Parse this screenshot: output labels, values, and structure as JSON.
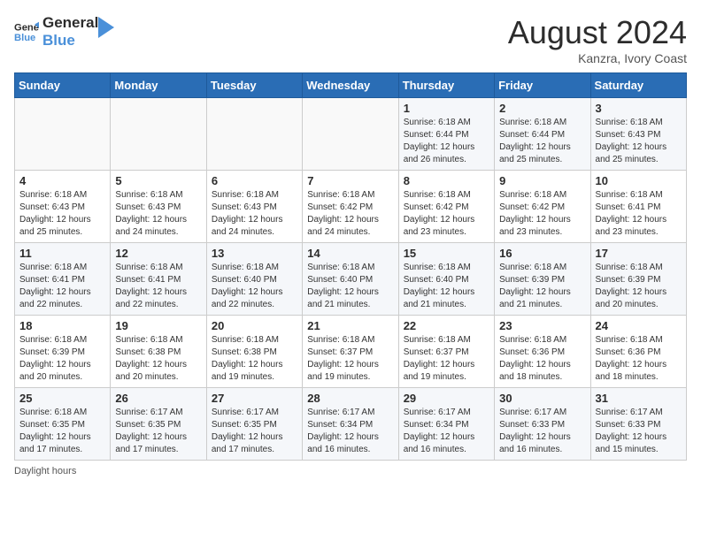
{
  "header": {
    "logo_line1": "General",
    "logo_line2": "Blue",
    "month_year": "August 2024",
    "location": "Kanzra, Ivory Coast"
  },
  "days_of_week": [
    "Sunday",
    "Monday",
    "Tuesday",
    "Wednesday",
    "Thursday",
    "Friday",
    "Saturday"
  ],
  "weeks": [
    [
      {
        "day": "",
        "info": ""
      },
      {
        "day": "",
        "info": ""
      },
      {
        "day": "",
        "info": ""
      },
      {
        "day": "",
        "info": ""
      },
      {
        "day": "1",
        "info": "Sunrise: 6:18 AM\nSunset: 6:44 PM\nDaylight: 12 hours\nand 26 minutes."
      },
      {
        "day": "2",
        "info": "Sunrise: 6:18 AM\nSunset: 6:44 PM\nDaylight: 12 hours\nand 25 minutes."
      },
      {
        "day": "3",
        "info": "Sunrise: 6:18 AM\nSunset: 6:43 PM\nDaylight: 12 hours\nand 25 minutes."
      }
    ],
    [
      {
        "day": "4",
        "info": "Sunrise: 6:18 AM\nSunset: 6:43 PM\nDaylight: 12 hours\nand 25 minutes."
      },
      {
        "day": "5",
        "info": "Sunrise: 6:18 AM\nSunset: 6:43 PM\nDaylight: 12 hours\nand 24 minutes."
      },
      {
        "day": "6",
        "info": "Sunrise: 6:18 AM\nSunset: 6:43 PM\nDaylight: 12 hours\nand 24 minutes."
      },
      {
        "day": "7",
        "info": "Sunrise: 6:18 AM\nSunset: 6:42 PM\nDaylight: 12 hours\nand 24 minutes."
      },
      {
        "day": "8",
        "info": "Sunrise: 6:18 AM\nSunset: 6:42 PM\nDaylight: 12 hours\nand 23 minutes."
      },
      {
        "day": "9",
        "info": "Sunrise: 6:18 AM\nSunset: 6:42 PM\nDaylight: 12 hours\nand 23 minutes."
      },
      {
        "day": "10",
        "info": "Sunrise: 6:18 AM\nSunset: 6:41 PM\nDaylight: 12 hours\nand 23 minutes."
      }
    ],
    [
      {
        "day": "11",
        "info": "Sunrise: 6:18 AM\nSunset: 6:41 PM\nDaylight: 12 hours\nand 22 minutes."
      },
      {
        "day": "12",
        "info": "Sunrise: 6:18 AM\nSunset: 6:41 PM\nDaylight: 12 hours\nand 22 minutes."
      },
      {
        "day": "13",
        "info": "Sunrise: 6:18 AM\nSunset: 6:40 PM\nDaylight: 12 hours\nand 22 minutes."
      },
      {
        "day": "14",
        "info": "Sunrise: 6:18 AM\nSunset: 6:40 PM\nDaylight: 12 hours\nand 21 minutes."
      },
      {
        "day": "15",
        "info": "Sunrise: 6:18 AM\nSunset: 6:40 PM\nDaylight: 12 hours\nand 21 minutes."
      },
      {
        "day": "16",
        "info": "Sunrise: 6:18 AM\nSunset: 6:39 PM\nDaylight: 12 hours\nand 21 minutes."
      },
      {
        "day": "17",
        "info": "Sunrise: 6:18 AM\nSunset: 6:39 PM\nDaylight: 12 hours\nand 20 minutes."
      }
    ],
    [
      {
        "day": "18",
        "info": "Sunrise: 6:18 AM\nSunset: 6:39 PM\nDaylight: 12 hours\nand 20 minutes."
      },
      {
        "day": "19",
        "info": "Sunrise: 6:18 AM\nSunset: 6:38 PM\nDaylight: 12 hours\nand 20 minutes."
      },
      {
        "day": "20",
        "info": "Sunrise: 6:18 AM\nSunset: 6:38 PM\nDaylight: 12 hours\nand 19 minutes."
      },
      {
        "day": "21",
        "info": "Sunrise: 6:18 AM\nSunset: 6:37 PM\nDaylight: 12 hours\nand 19 minutes."
      },
      {
        "day": "22",
        "info": "Sunrise: 6:18 AM\nSunset: 6:37 PM\nDaylight: 12 hours\nand 19 minutes."
      },
      {
        "day": "23",
        "info": "Sunrise: 6:18 AM\nSunset: 6:36 PM\nDaylight: 12 hours\nand 18 minutes."
      },
      {
        "day": "24",
        "info": "Sunrise: 6:18 AM\nSunset: 6:36 PM\nDaylight: 12 hours\nand 18 minutes."
      }
    ],
    [
      {
        "day": "25",
        "info": "Sunrise: 6:18 AM\nSunset: 6:35 PM\nDaylight: 12 hours\nand 17 minutes."
      },
      {
        "day": "26",
        "info": "Sunrise: 6:17 AM\nSunset: 6:35 PM\nDaylight: 12 hours\nand 17 minutes."
      },
      {
        "day": "27",
        "info": "Sunrise: 6:17 AM\nSunset: 6:35 PM\nDaylight: 12 hours\nand 17 minutes."
      },
      {
        "day": "28",
        "info": "Sunrise: 6:17 AM\nSunset: 6:34 PM\nDaylight: 12 hours\nand 16 minutes."
      },
      {
        "day": "29",
        "info": "Sunrise: 6:17 AM\nSunset: 6:34 PM\nDaylight: 12 hours\nand 16 minutes."
      },
      {
        "day": "30",
        "info": "Sunrise: 6:17 AM\nSunset: 6:33 PM\nDaylight: 12 hours\nand 16 minutes."
      },
      {
        "day": "31",
        "info": "Sunrise: 6:17 AM\nSunset: 6:33 PM\nDaylight: 12 hours\nand 15 minutes."
      }
    ]
  ],
  "footer": {
    "note": "Daylight hours"
  }
}
